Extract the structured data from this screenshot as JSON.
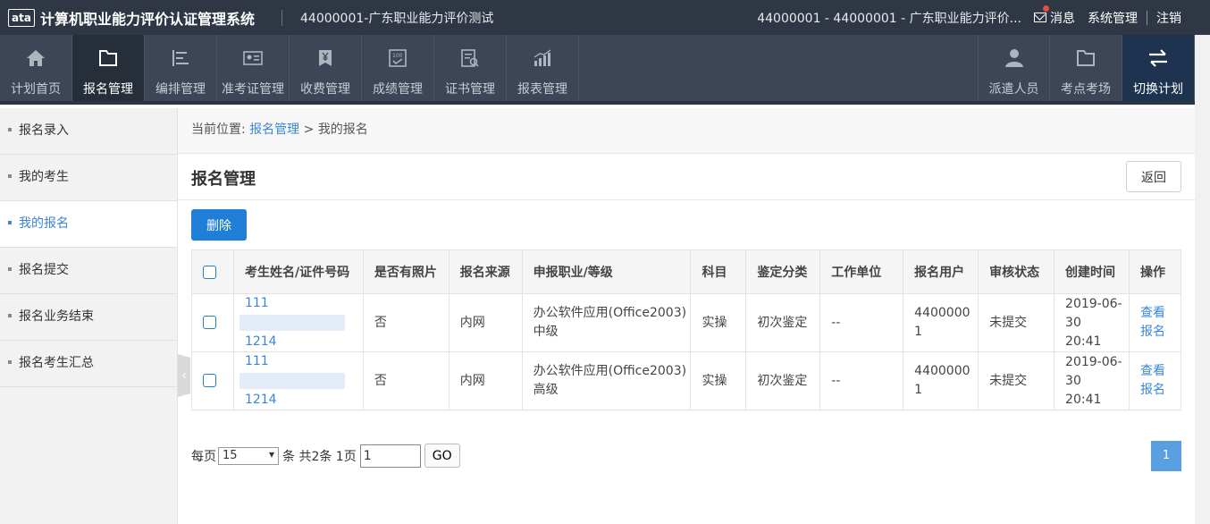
{
  "topbar": {
    "logo": "ata",
    "app_title": "计算机职业能力评价认证管理系统",
    "plan_name": "44000001-广东职业能力评价测试",
    "user_info": "44000001 - 44000001 - 广东职业能力评价...",
    "messages": "消息",
    "system_admin": "系统管理",
    "logout": "注销"
  },
  "nav": {
    "items": [
      {
        "label": "计划首页",
        "icon": "home-icon"
      },
      {
        "label": "报名管理",
        "icon": "folder-icon"
      },
      {
        "label": "编排管理",
        "icon": "align-icon"
      },
      {
        "label": "准考证管理",
        "icon": "id-card-icon"
      },
      {
        "label": "收费管理",
        "icon": "yen-icon"
      },
      {
        "label": "成绩管理",
        "icon": "score-icon"
      },
      {
        "label": "证书管理",
        "icon": "certificate-icon"
      },
      {
        "label": "报表管理",
        "icon": "chart-icon"
      }
    ],
    "right_items": [
      {
        "label": "派遣人员",
        "icon": "person-icon"
      },
      {
        "label": "考点考场",
        "icon": "folder-icon"
      },
      {
        "label": "切换计划",
        "icon": "switch-icon"
      }
    ]
  },
  "sidebar": {
    "items": [
      {
        "label": "报名录入"
      },
      {
        "label": "我的考生"
      },
      {
        "label": "我的报名"
      },
      {
        "label": "报名提交"
      },
      {
        "label": "报名业务结束"
      },
      {
        "label": "报名考生汇总"
      }
    ]
  },
  "breadcrumb": {
    "prefix": "当前位置:",
    "link": "报名管理",
    "sep": ">",
    "current": "我的报名"
  },
  "page": {
    "title": "报名管理",
    "back_label": "返回",
    "delete_label": "删除"
  },
  "table": {
    "headers": [
      "考生姓名/证件号码",
      "是否有照片",
      "报名来源",
      "申报职业/等级",
      "科目",
      "鉴定分类",
      "工作单位",
      "报名用户",
      "审核状态",
      "创建时间",
      "操作"
    ],
    "rows": [
      {
        "name": "111",
        "id_tail": "1214",
        "photo": "否",
        "source": "内网",
        "occupation": "办公软件应用(Office2003)",
        "level": "中级",
        "subject": "实操",
        "category": "初次鉴定",
        "work_unit": "--",
        "user_a": "4400000",
        "user_b": "1",
        "status": "未提交",
        "date": "2019-06-",
        "date2": "30",
        "time": "20:41",
        "action_a": "查看",
        "action_b": "报名"
      },
      {
        "name": "111",
        "id_tail": "1214",
        "photo": "否",
        "source": "内网",
        "occupation": "办公软件应用(Office2003)",
        "level": "高级",
        "subject": "实操",
        "category": "初次鉴定",
        "work_unit": "--",
        "user_a": "4400000",
        "user_b": "1",
        "status": "未提交",
        "date": "2019-06-",
        "date2": "30",
        "time": "20:41",
        "action_a": "查看",
        "action_b": "报名"
      }
    ]
  },
  "pager": {
    "per_page_label": "每页",
    "per_page": "15",
    "summary": "条 共2条 1页",
    "page_value": "1",
    "go_label": "GO",
    "current_page": "1"
  }
}
